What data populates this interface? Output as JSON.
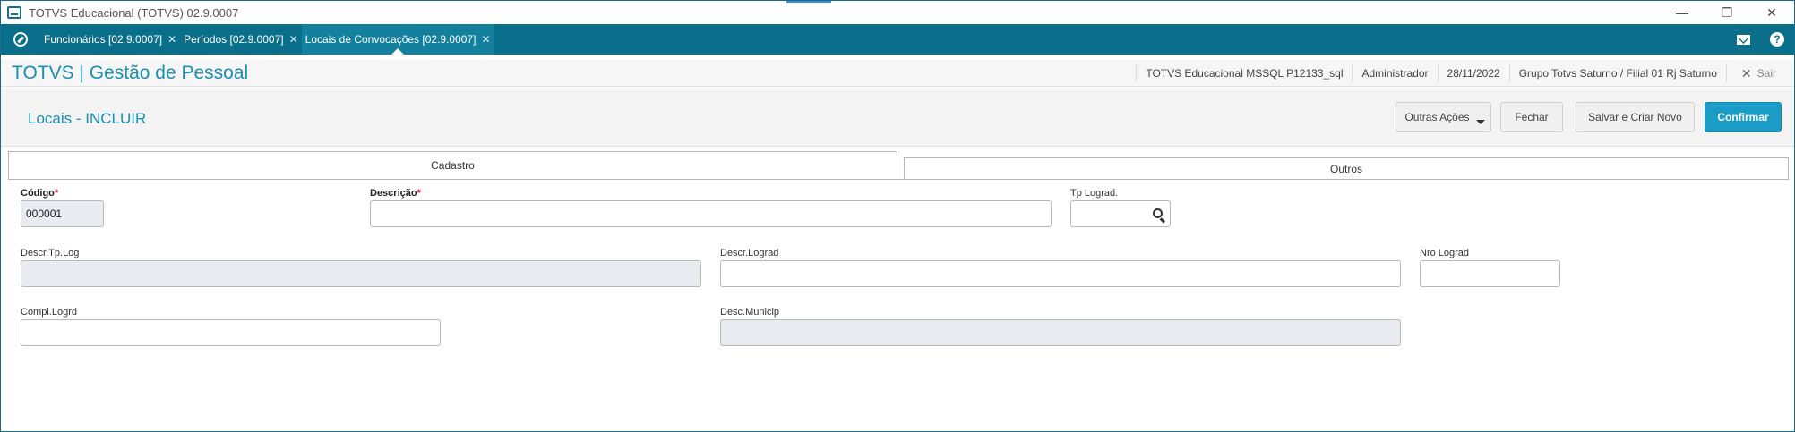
{
  "window": {
    "title": "TOTVS Educacional (TOTVS) 02.9.0007",
    "controls": [
      "—",
      "❐",
      "✕"
    ]
  },
  "tabs": [
    {
      "label": "Funcionários [02.9.0007]",
      "active": false
    },
    {
      "label": "Períodos [02.9.0007]",
      "active": false
    },
    {
      "label": "Locais de Convocações [02.9.0007]",
      "active": true
    }
  ],
  "header": {
    "module_title": "TOTVS | Gestão de Pessoal",
    "environment": "TOTVS Educacional MSSQL P12133_sql",
    "user": "Administrador",
    "date": "28/11/2022",
    "company": "Grupo Totvs Saturno / Filial 01 Rj Saturno",
    "exit_label": "Sair"
  },
  "page": {
    "title": "Locais - INCLUIR",
    "buttons": {
      "more_actions": "Outras Ações",
      "close": "Fechar",
      "save_new": "Salvar e Criar Novo",
      "confirm": "Confirmar"
    },
    "folders": [
      {
        "label": "Cadastro",
        "active": true
      },
      {
        "label": "Outros",
        "active": false
      }
    ]
  },
  "form": {
    "codigo": {
      "label": "Código",
      "value": "000001"
    },
    "descricao": {
      "label": "Descrição",
      "value": ""
    },
    "tp_lograd": {
      "label": "Tp Lograd.",
      "value": ""
    },
    "descr_tp_log": {
      "label": "Descr.Tp.Log",
      "value": ""
    },
    "descr_lograd": {
      "label": "Descr.Lograd",
      "value": ""
    },
    "nro_lograd": {
      "label": "Nro Lograd",
      "value": ""
    },
    "compl_logrd": {
      "label": "Compl.Logrd",
      "value": ""
    },
    "desc_municip": {
      "label": "Desc.Municip",
      "value": ""
    }
  },
  "colors": {
    "accent": "#0a6f8b",
    "title_blue": "#1a8fb3",
    "primary_button": "#1a9cc6",
    "required": "#d0021b"
  }
}
